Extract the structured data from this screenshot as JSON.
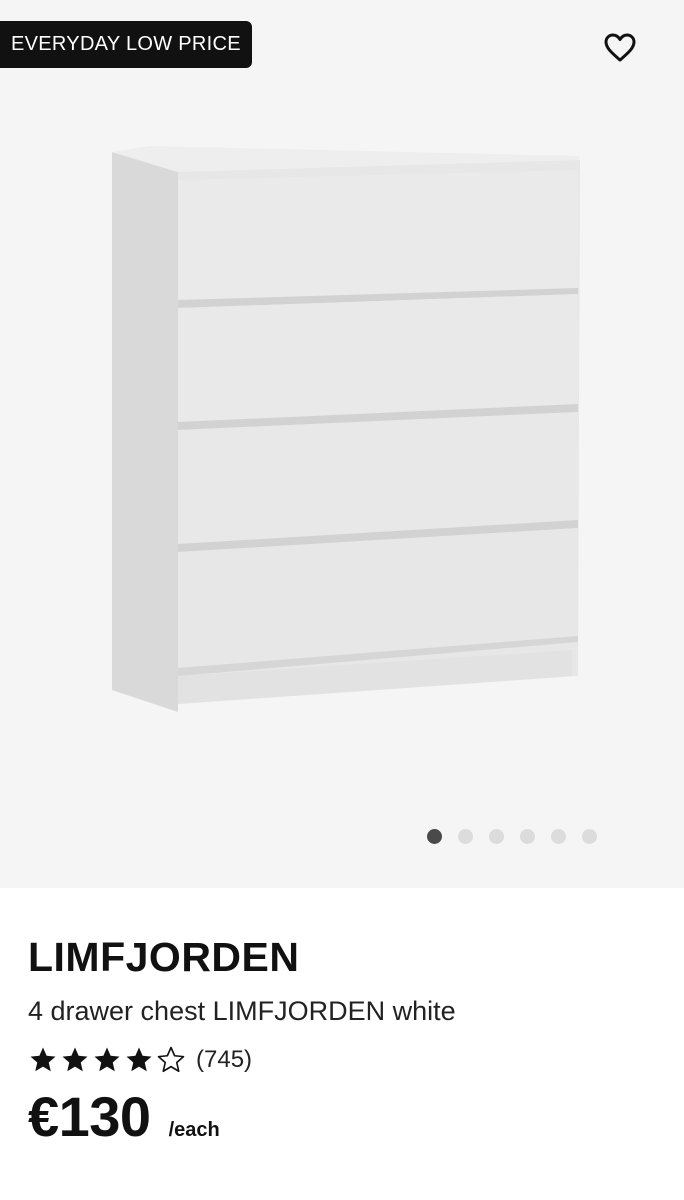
{
  "gallery": {
    "badge": "EVERYDAY LOW PRICE",
    "favorite_icon": "heart-outline-icon",
    "image": "white 4 drawer chest",
    "dots_total": 6,
    "dots_active_index": 0
  },
  "product": {
    "name": "LIMFJORDEN",
    "description": "4 drawer chest LIMFJORDEN white",
    "rating": {
      "stars": 4,
      "max": 5,
      "count_label": "(745)"
    },
    "price": {
      "amount": "€130",
      "unit": "/each"
    }
  },
  "colors": {
    "badge_bg": "#111111",
    "gallery_bg": "#f5f5f5",
    "active_dot": "#4a4a4a",
    "inactive_dot": "#dcdcdc"
  }
}
